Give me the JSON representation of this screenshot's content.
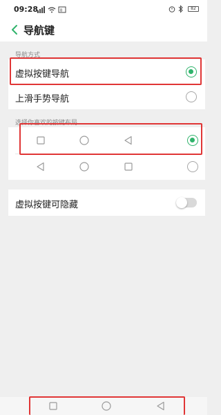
{
  "status_bar": {
    "time": "09:28",
    "battery": "82",
    "icons": [
      "signal-icon",
      "wifi-icon",
      "alarm-icon",
      "bluetooth-icon",
      "battery-icon"
    ]
  },
  "header": {
    "title": "导航键",
    "back_icon": "back-chevron-icon"
  },
  "navigation_mode": {
    "section_label": "导航方式",
    "options": [
      {
        "label": "虚拟按键导航",
        "selected": true
      },
      {
        "label": "上滑手势导航",
        "selected": false
      }
    ]
  },
  "key_layout": {
    "section_label": "选择你喜欢的按键布局",
    "options": [
      {
        "keys": [
          "square-icon",
          "circle-icon",
          "triangle-left-icon"
        ],
        "selected": true
      },
      {
        "keys": [
          "triangle-left-icon",
          "circle-icon",
          "square-icon"
        ],
        "selected": false
      }
    ]
  },
  "hide_keys": {
    "label": "虚拟按键可隐藏",
    "enabled": false
  },
  "nav_bar": {
    "keys": [
      "square-icon",
      "circle-icon",
      "triangle-left-icon"
    ]
  },
  "colors": {
    "accent": "#2fb36b",
    "highlight": "#e03535"
  }
}
